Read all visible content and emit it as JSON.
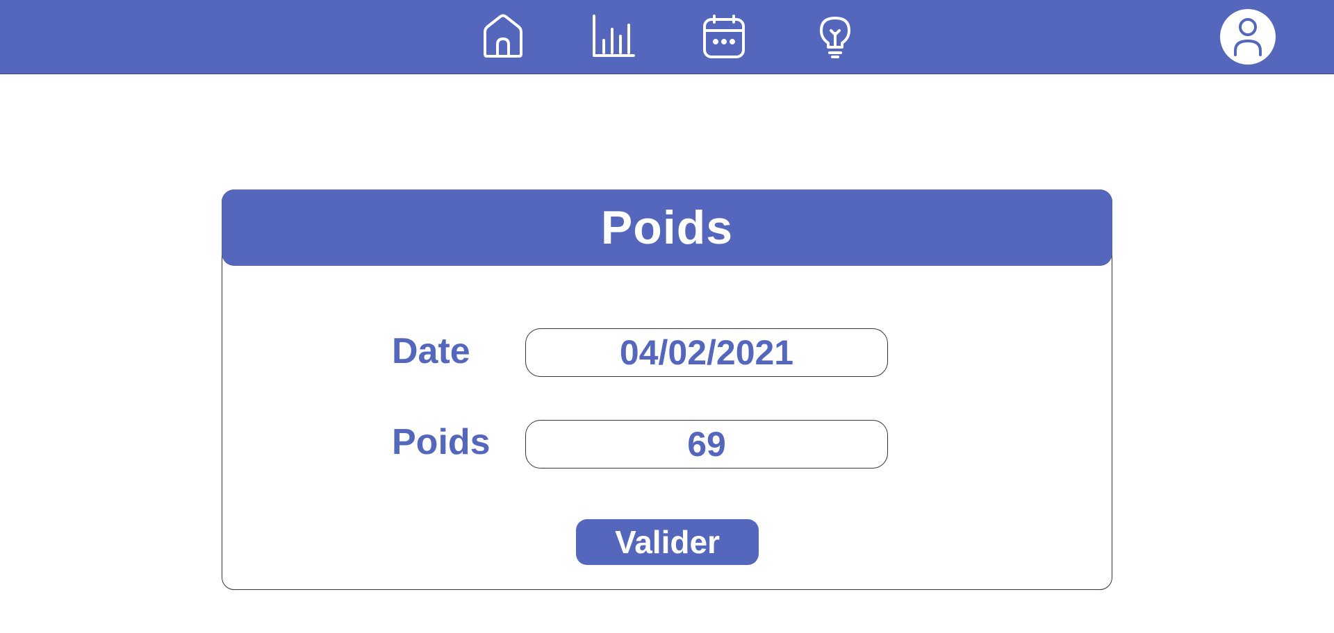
{
  "nav": {
    "icons": [
      "home-icon",
      "chart-bar-icon",
      "calendar-icon",
      "lightbulb-icon",
      "user-icon"
    ],
    "accent_color": "#5567bd"
  },
  "card": {
    "title": "Poids"
  },
  "form": {
    "date_label": "Date",
    "date_value": "04/02/2021",
    "weight_label": "Poids",
    "weight_value": "69",
    "submit_label": "Valider"
  }
}
